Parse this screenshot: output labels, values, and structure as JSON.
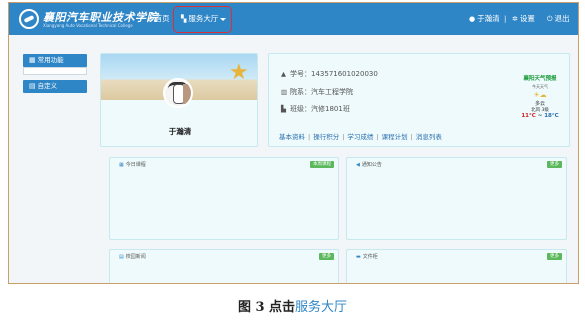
{
  "header": {
    "logo_cn": "襄阳汽车职业技术学院",
    "logo_en": "Xiangyang Auto Vocational Technical College",
    "nav_home": "首页",
    "nav_service": "服务大厅",
    "user": "于瀚清",
    "settings": "设置",
    "logout": "退出",
    "separator": "|"
  },
  "sidebar": {
    "common": "常用功能",
    "custom": "自定义"
  },
  "profile": {
    "name": "于瀚清"
  },
  "info": {
    "student_id": "学号：143571601020030",
    "department": "院系：汽车工程学院",
    "class": "班级：汽修1801班",
    "links": [
      "基本资料",
      "操行积分",
      "学习成绩",
      "课程计划",
      "消息列表"
    ],
    "link_sep": "|"
  },
  "weather": {
    "title": "襄阳天气预报",
    "subtitle": "今天天气",
    "desc": "多云",
    "wind": "北风 3级",
    "temp_high": "11°C",
    "temp_sep": "~",
    "temp_low": "18°C"
  },
  "panels": {
    "course_title": "今日课程",
    "course_more": "本周课程",
    "notice_title": "通知公告",
    "notice_more": "更多",
    "news_title": "校园新闻",
    "news_more": "更多",
    "docs_title": "文件柜",
    "docs_more": "更多"
  },
  "caption": {
    "prefix": "图 3 点击",
    "highlight": "服务大厅"
  },
  "colors": {
    "accent": "#2f86c7",
    "highlight_box": "#d9303a",
    "more_button": "#5cb85c"
  }
}
